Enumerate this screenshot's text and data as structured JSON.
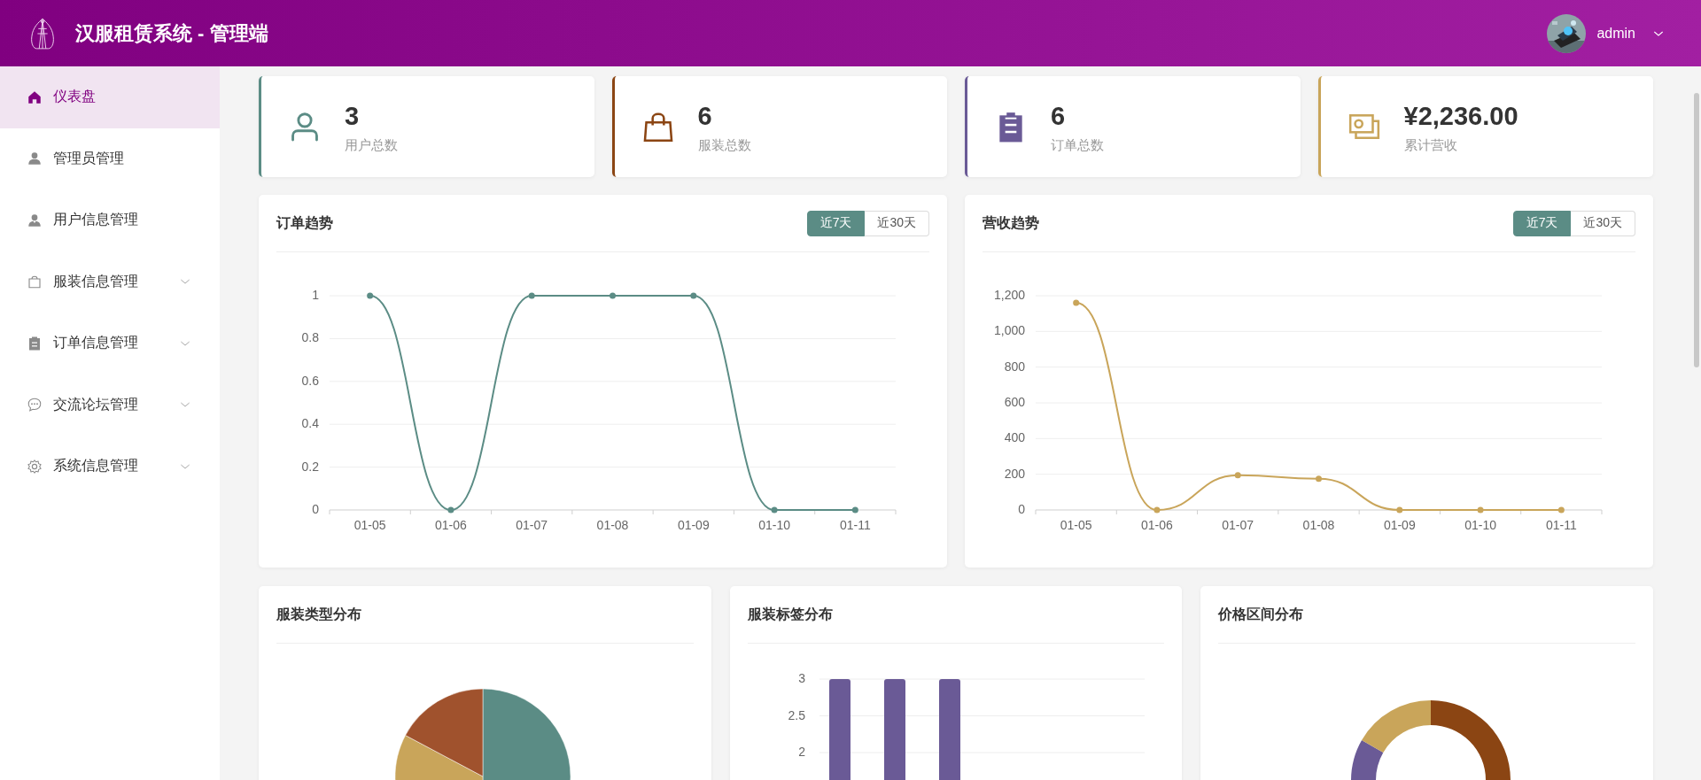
{
  "header": {
    "title": "汉服租赁系统 - 管理端",
    "user": {
      "name": "admin"
    }
  },
  "sidebar": {
    "items": [
      {
        "label": "仪表盘",
        "kind": "link",
        "selected": true
      },
      {
        "label": "管理员管理",
        "kind": "link",
        "selected": false
      },
      {
        "label": "用户信息管理",
        "kind": "link",
        "selected": false
      },
      {
        "label": "服装信息管理",
        "kind": "submenu",
        "selected": false,
        "expanded": false
      },
      {
        "label": "订单信息管理",
        "kind": "submenu",
        "selected": false,
        "expanded": false
      },
      {
        "label": "交流论坛管理",
        "kind": "submenu",
        "selected": false,
        "expanded": false
      },
      {
        "label": "系统信息管理",
        "kind": "submenu",
        "selected": false,
        "expanded": false
      }
    ]
  },
  "stats": [
    {
      "value": "3",
      "label": "用户总数",
      "color": "#5b8c85"
    },
    {
      "value": "6",
      "label": "服装总数",
      "color": "#8b4513"
    },
    {
      "value": "6",
      "label": "订单总数",
      "color": "#6a5a96"
    },
    {
      "value": "¥2,236.00",
      "label": "累计营收",
      "color": "#c9a55a"
    }
  ],
  "trend_charts": [
    {
      "title": "订单趋势",
      "ranges": [
        {
          "label": "近7天",
          "selected": true
        },
        {
          "label": "近30天",
          "selected": false
        }
      ],
      "chart_data": {
        "type": "line",
        "grid": true,
        "categories": [
          "01-05",
          "01-06",
          "01-07",
          "01-08",
          "01-09",
          "01-10",
          "01-11"
        ],
        "ylim": [
          0,
          1
        ],
        "yticks": [
          0,
          0.2,
          0.4,
          0.6,
          0.8,
          1
        ],
        "series": [
          {
            "color": "#5b8c85",
            "marker": true,
            "values": [
              1,
              0,
              1,
              1,
              1,
              0,
              0
            ]
          }
        ]
      }
    },
    {
      "title": "营收趋势",
      "ranges": [
        {
          "label": "近7天",
          "selected": true
        },
        {
          "label": "近30天",
          "selected": false
        }
      ],
      "chart_data": {
        "type": "line",
        "grid": true,
        "categories": [
          "01-05",
          "01-06",
          "01-07",
          "01-08",
          "01-09",
          "01-10",
          "01-11"
        ],
        "ylim": [
          0,
          1200
        ],
        "yticks": [
          0,
          200,
          400,
          600,
          800,
          {
            "value": 1000,
            "label": "1,000"
          },
          {
            "value": 1200,
            "label": "1,200"
          }
        ],
        "series": [
          {
            "color": "#c9a55a",
            "marker": true,
            "values": [
              1160,
              0,
              195,
              175,
              0,
              0,
              0
            ]
          }
        ]
      }
    }
  ],
  "distribution_cards": [
    {
      "title": "服装类型分布",
      "kind": "pie"
    },
    {
      "title": "服装标签分布",
      "kind": "bar",
      "chart_data": {
        "type": "bar",
        "grid": true,
        "ylim": [
          0,
          3
        ],
        "yticks": [
          2,
          2.5,
          3
        ],
        "series": [
          {
            "color": "#6a5a96",
            "values": [
              3,
              3,
              3
            ]
          }
        ]
      }
    },
    {
      "title": "价格区间分布",
      "kind": "donut"
    }
  ]
}
